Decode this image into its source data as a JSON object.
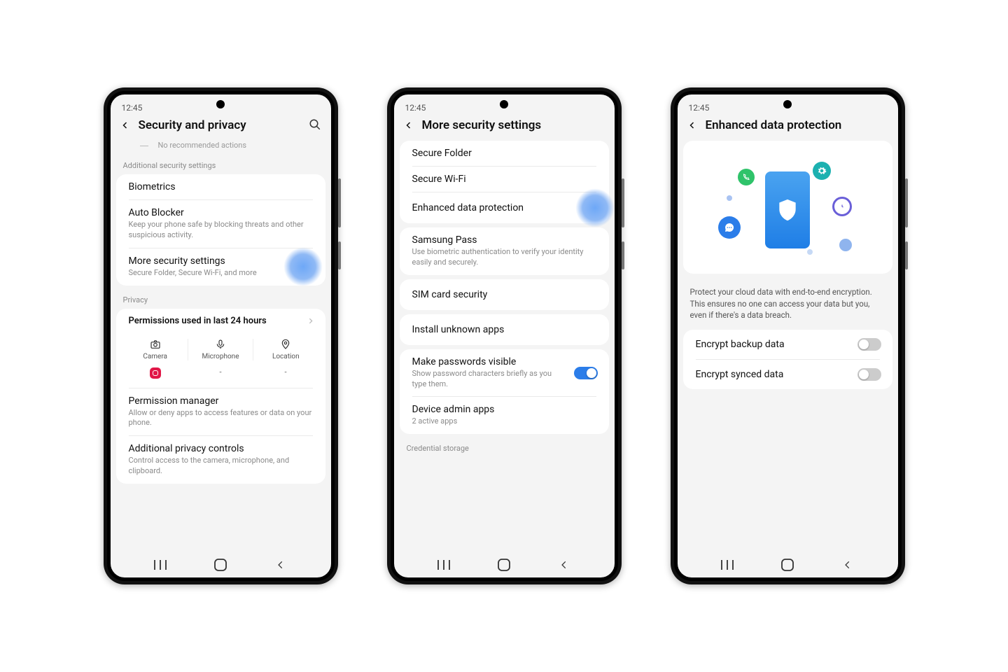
{
  "status_time": "12:45",
  "screen1": {
    "title": "Security and privacy",
    "recommended": "No recommended actions",
    "section_additional": "Additional security settings",
    "biometrics": "Biometrics",
    "autoblocker": "Auto Blocker",
    "autoblocker_sub": "Keep your phone safe by blocking threats and other suspicious activity.",
    "more": "More security settings",
    "more_sub": "Secure Folder, Secure Wi-Fi, and more",
    "section_privacy": "Privacy",
    "perm_title": "Permissions used in last 24 hours",
    "perm_camera": "Camera",
    "perm_mic": "Microphone",
    "perm_loc": "Location",
    "perm_dash1": "-",
    "perm_dash2": "-",
    "perm_mgr": "Permission manager",
    "perm_mgr_sub": "Allow or deny apps to access features or data on your phone.",
    "add_priv": "Additional privacy controls",
    "add_priv_sub": "Control access to the camera, microphone, and clipboard."
  },
  "screen2": {
    "title": "More security settings",
    "secure_folder": "Secure Folder",
    "secure_wifi": "Secure Wi-Fi",
    "edp": "Enhanced data protection",
    "pass": "Samsung Pass",
    "pass_sub": "Use biometric authentication to verify your identity easily and securely.",
    "sim": "SIM card security",
    "unknown": "Install unknown apps",
    "pwvis": "Make passwords visible",
    "pwvis_sub": "Show password characters briefly as you type them.",
    "admin": "Device admin apps",
    "admin_sub": "2 active apps",
    "cred": "Credential storage"
  },
  "screen3": {
    "title": "Enhanced data protection",
    "desc": "Protect your cloud data with end-to-end encryption. This ensures no one can access your data but you, even if there's a data breach.",
    "enc_backup": "Encrypt backup data",
    "enc_sync": "Encrypt synced data"
  }
}
